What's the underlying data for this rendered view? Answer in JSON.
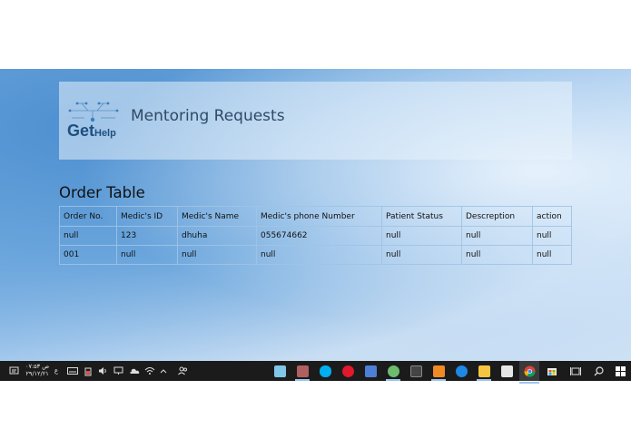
{
  "header": {
    "logo_text_main": "Get",
    "logo_text_sub": "Help",
    "title": "Mentoring Requests"
  },
  "table": {
    "title": "Order Table",
    "columns": [
      "Order No.",
      "Medic's ID",
      "Medic's Name",
      "Medic's phone Number",
      "Patient Status",
      "Descreption",
      "action"
    ],
    "rows": [
      [
        "null",
        "123",
        "dhuha",
        "055674662",
        "null",
        "null",
        "null"
      ],
      [
        "001",
        "null",
        "null",
        "null",
        "null",
        "null",
        "null"
      ]
    ]
  },
  "taskbar": {
    "clock_time": "۰۷:۵۳ ص",
    "clock_date": "۲۹/۱۲/۲۱",
    "lang": "ع",
    "tray_icons": [
      "notification-icon",
      "keyboard-icon",
      "power-icon",
      "volume-icon",
      "display-icon",
      "onedrive-icon",
      "network-icon",
      "chevron-up-icon",
      "people-icon"
    ],
    "apps": [
      {
        "name": "windows-start-icon",
        "color": "#ffffff"
      },
      {
        "name": "search-icon",
        "color": "#ffffff"
      },
      {
        "name": "task-view-icon",
        "color": "#ffffff"
      },
      {
        "name": "store-icon",
        "color": "#f3b73a"
      },
      {
        "name": "chrome-icon",
        "color": "#db4437"
      },
      {
        "name": "file-explorer-icon",
        "color": "#f5c542"
      },
      {
        "name": "edge-icon",
        "color": "#1e88e5"
      },
      {
        "name": "sublime-icon",
        "color": "#f08a24"
      },
      {
        "name": "terminal-icon",
        "color": "#444444"
      },
      {
        "name": "android-studio-icon",
        "color": "#6dbb6d"
      },
      {
        "name": "paint-icon",
        "color": "#4d7fd6"
      },
      {
        "name": "opera-icon",
        "color": "#e0192d"
      },
      {
        "name": "skype-icon",
        "color": "#00aff0"
      },
      {
        "name": "media-player-icon",
        "color": "#b06060"
      },
      {
        "name": "app-icon",
        "color": "#7fc6e8"
      }
    ]
  }
}
